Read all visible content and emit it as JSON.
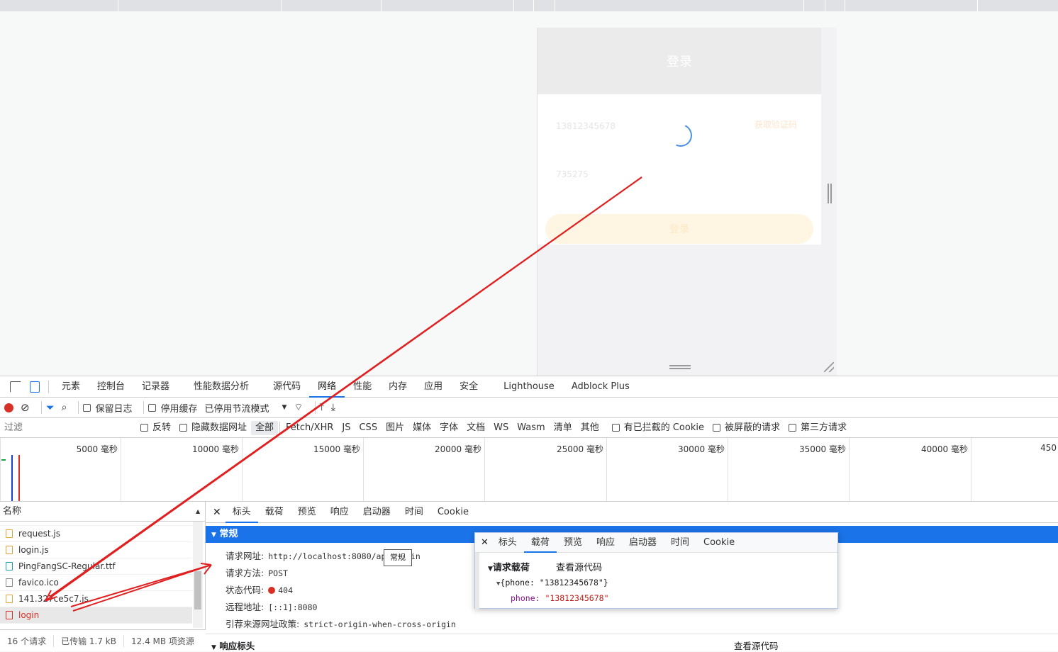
{
  "device": {
    "header_title": "登录",
    "phone_placeholder": "13812345678",
    "get_code": "获取验证码",
    "code_placeholder": "735275",
    "login_button": "登录"
  },
  "devtools": {
    "tabs": [
      "元素",
      "控制台",
      "记录器",
      "性能数据分析",
      "源代码",
      "网络",
      "性能",
      "内存",
      "应用",
      "安全",
      "Lighthouse",
      "Adblock Plus"
    ],
    "selected_tab": "网络",
    "toolbar": {
      "preserve_log": "保留日志",
      "disable_cache": "停用缓存",
      "throttling": "已停用节流模式"
    },
    "filter": {
      "placeholder": "过滤",
      "invert": "反转",
      "hide_data_urls": "隐藏数据网址",
      "types": [
        "全部",
        "Fetch/XHR",
        "JS",
        "CSS",
        "图片",
        "媒体",
        "字体",
        "文档",
        "WS",
        "Wasm",
        "清单",
        "其他"
      ],
      "blocked_cookies": "有已拦截的 Cookie",
      "blocked_requests": "被屏蔽的请求",
      "third_party": "第三方请求"
    },
    "timeline_ticks": [
      "5000 毫秒",
      "10000 毫秒",
      "15000 毫秒",
      "20000 毫秒",
      "25000 毫秒",
      "30000 毫秒",
      "35000 毫秒",
      "40000 毫秒",
      "450"
    ],
    "request_list": {
      "header": "名称",
      "items": [
        "request.js",
        "login.js",
        "PingFangSC-Regular.ttf",
        "favico.ico",
        "141.327ce5c7.js",
        "login"
      ]
    },
    "status_bar": [
      "16 个请求",
      "已传输 1.7 kB",
      "12.4 MB 项资源"
    ],
    "detail_tabs": [
      "标头",
      "载荷",
      "预览",
      "响应",
      "启动器",
      "时间",
      "Cookie"
    ],
    "general": {
      "title": "常规",
      "request_url_label": "请求网址:",
      "request_url": "http://localhost:8080/api/login",
      "method_label": "请求方法:",
      "method": "POST",
      "status_label": "状态代码:",
      "status": "404",
      "remote_label": "远程地址:",
      "remote": "[::1]:8080",
      "referrer_label": "引荐来源网址政策:",
      "referrer": "strict-origin-when-cross-origin"
    },
    "response_headers_title": "响应标头",
    "view_source": "查看源代码",
    "tooltip": "常规"
  },
  "popup": {
    "tabs": [
      "标头",
      "载荷",
      "预览",
      "响应",
      "启动器",
      "时间",
      "Cookie"
    ],
    "selected_tab": "载荷",
    "payload_title": "请求载荷",
    "view_source": "查看源代码",
    "object_summary": "{phone: \"13812345678\"}",
    "key": "phone:",
    "value": "\"13812345678\""
  }
}
